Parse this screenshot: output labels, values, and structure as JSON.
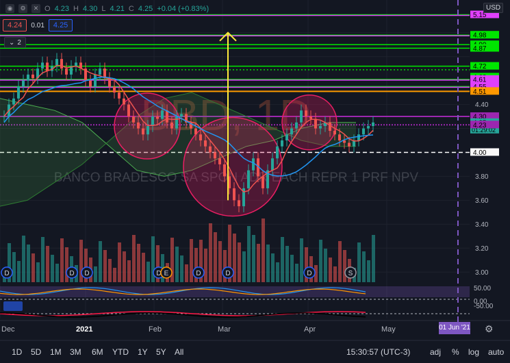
{
  "legend": {
    "open_label": "O",
    "open": "4.23",
    "high_label": "H",
    "high": "4.30",
    "low_label": "L",
    "low": "4.21",
    "close_label": "C",
    "close": "4.25",
    "change": "+0.04 (+0.83%)"
  },
  "order_panel": {
    "bid": "4.24",
    "spread": "0.01",
    "ask": "4.25"
  },
  "indicators_toggle": {
    "count": "2"
  },
  "currency": "USD",
  "watermark": {
    "symbol": "BBD, 1D",
    "description": "BANCO BRADESCO SA SPON ADR EACH REPR 1 PRF NPV"
  },
  "price_axis": {
    "ticks": [
      "5.15",
      "4.98",
      "4.90",
      "4.87",
      "4.72",
      "4.63",
      "4.61",
      "4.55",
      "4.51",
      "4.40",
      "4.30",
      "4.25",
      "4.23",
      "4.00",
      "3.80",
      "3.60",
      "3.40",
      "3.20",
      "3.00"
    ],
    "current_price": "4.25",
    "countdown": "01:29:02"
  },
  "oscillator_axis": {
    "ticks": [
      "50.00",
      "0.00",
      "-50.00"
    ]
  },
  "time_axis": {
    "labels": [
      "Dec",
      "2021",
      "Feb",
      "Mar",
      "Apr",
      "May"
    ],
    "crosshair_date": "01 Jun '21"
  },
  "events": [
    "D",
    "D",
    "D",
    "D",
    "E",
    "D",
    "D",
    "D",
    "S"
  ],
  "timeframes": [
    "1D",
    "5D",
    "1M",
    "3M",
    "6M",
    "YTD",
    "1Y",
    "5Y",
    "All"
  ],
  "bottom_right": {
    "clock": "15:30:57 (UTC-3)",
    "adj": "adj",
    "percent": "%",
    "log": "log",
    "auto": "auto"
  },
  "colors": {
    "background": "#131722",
    "up": "#26a69a",
    "down": "#ef5350",
    "green_level": "#00e600",
    "magenta_level": "#e040fb",
    "orange_level": "#ff9800",
    "purple_level": "#9c27b0",
    "arrow": "#ffeb3b",
    "circle_fill": "#e91e63",
    "crosshair": "#7e57c2"
  },
  "chart_data": {
    "type": "candlestick",
    "symbol": "BBD",
    "interval": "1D",
    "x_range": [
      "Dec",
      "01 Jun '21"
    ],
    "y_range": [
      2.95,
      5.25
    ],
    "levels": {
      "green": [
        5.15,
        4.98,
        4.9,
        4.87,
        4.72,
        4.61,
        4.55,
        4.51
      ],
      "magenta": [
        5.15,
        4.98,
        4.61,
        4.55
      ],
      "orange": [
        4.51
      ],
      "purple": [
        4.3,
        4.23
      ],
      "dashed_white": [
        4.0
      ]
    },
    "shaded_zones": [
      "Feb",
      "Mar",
      "Apr"
    ],
    "arrow": {
      "from": 3.6,
      "to": 5.0
    },
    "oscillator_range": [
      -50,
      50
    ]
  }
}
